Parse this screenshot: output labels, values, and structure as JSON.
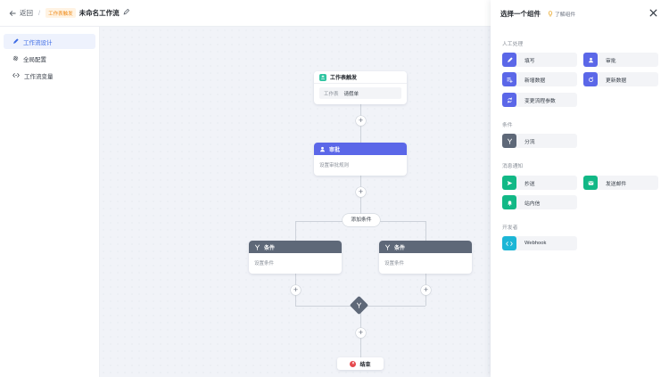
{
  "header": {
    "back_label": "返回",
    "separator": "/",
    "tag": "工作表触发",
    "title": "未命名工作流"
  },
  "sidebar": {
    "items": [
      {
        "label": "工作流设计",
        "icon": "pencil-icon",
        "active": true
      },
      {
        "label": "全局配置",
        "icon": "gear-icon",
        "active": false
      },
      {
        "label": "工作流变量",
        "icon": "code-icon",
        "active": false
      }
    ]
  },
  "canvas": {
    "trigger": {
      "title": "工作表触发",
      "field_label": "工作表",
      "field_value": "请假单"
    },
    "approve": {
      "title": "审批",
      "placeholder": "设置审批规则"
    },
    "add_condition": "添加条件",
    "branches": [
      {
        "title": "条件",
        "placeholder": "设置条件"
      },
      {
        "title": "条件",
        "placeholder": "设置条件"
      }
    ],
    "end": {
      "label": "结束"
    }
  },
  "panel": {
    "title": "选择一个组件",
    "learn_label": "了解组件",
    "sections": [
      {
        "title": "人工处理",
        "items": [
          {
            "label": "填写",
            "icon": "pencil-icon",
            "color": "#5b67e8"
          },
          {
            "label": "审批",
            "icon": "user-icon",
            "color": "#5b67e8"
          },
          {
            "label": "新增数据",
            "icon": "add-data-icon",
            "color": "#5b67e8"
          },
          {
            "label": "更新数据",
            "icon": "refresh-icon",
            "color": "#5b67e8"
          },
          {
            "label": "变更流程参数",
            "icon": "swap-icon",
            "color": "#5b67e8"
          }
        ]
      },
      {
        "title": "条件",
        "items": [
          {
            "label": "分流",
            "icon": "branch-icon",
            "color": "#5e6878"
          }
        ]
      },
      {
        "title": "消息通知",
        "items": [
          {
            "label": "抄送",
            "icon": "send-icon",
            "color": "#12b886"
          },
          {
            "label": "发送邮件",
            "icon": "mail-icon",
            "color": "#12b886"
          },
          {
            "label": "站内信",
            "icon": "bell-icon",
            "color": "#12b886"
          }
        ]
      },
      {
        "title": "开发者",
        "items": [
          {
            "label": "Webhook",
            "icon": "code-icon",
            "color": "#1cb6d6"
          }
        ]
      }
    ]
  }
}
